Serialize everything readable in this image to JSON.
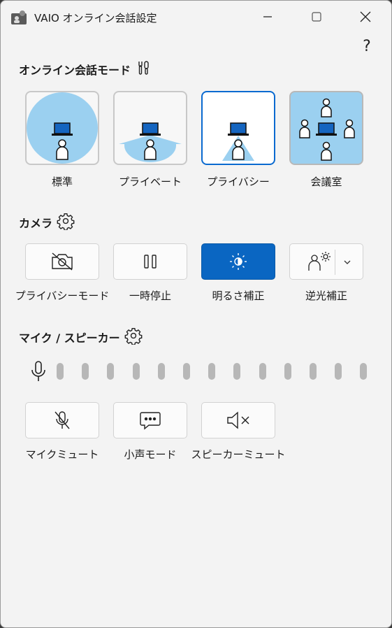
{
  "window": {
    "title": "VAIO オンライン会話設定",
    "help": "?"
  },
  "mode_section": {
    "title": "オンライン会話モード",
    "options": [
      {
        "label": "標準",
        "selected": false
      },
      {
        "label": "プライベート",
        "selected": false
      },
      {
        "label": "プライバシー",
        "selected": true
      },
      {
        "label": "会議室",
        "selected": false
      }
    ]
  },
  "camera_section": {
    "title": "カメラ",
    "buttons": [
      {
        "label": "プライバシーモード",
        "active": false
      },
      {
        "label": "一時停止",
        "active": false
      },
      {
        "label": "明るさ補正",
        "active": true
      },
      {
        "label": "逆光補正",
        "active": false
      }
    ]
  },
  "mic_section": {
    "title": "マイク / スピーカー",
    "level_bars": 13,
    "buttons": [
      {
        "label": "マイクミュート"
      },
      {
        "label": "小声モード"
      },
      {
        "label": "スピーカーミュート"
      }
    ]
  },
  "colors": {
    "accent": "#0a66c2",
    "zone": "#9bd0f0",
    "laptop": "#1565c0"
  }
}
